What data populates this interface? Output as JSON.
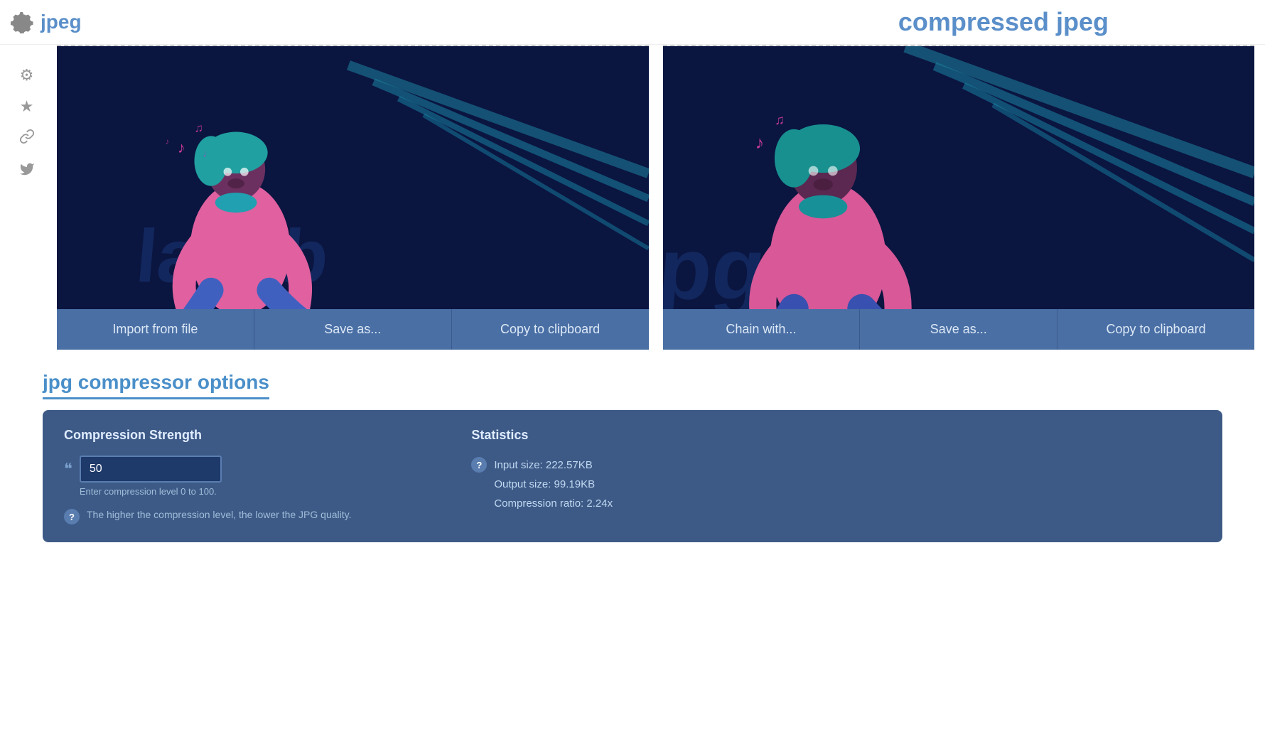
{
  "header": {
    "app_title": "jpeg",
    "compressed_title": "compressed jpeg"
  },
  "sidebar": {
    "icons": [
      {
        "name": "gear-icon",
        "symbol": "⚙"
      },
      {
        "name": "star-icon",
        "symbol": "★"
      },
      {
        "name": "link-icon",
        "symbol": "🔗"
      },
      {
        "name": "twitter-icon",
        "symbol": "🐦"
      }
    ]
  },
  "left_panel": {
    "buttons": [
      {
        "name": "import-from-file-button",
        "label": "Import from file"
      },
      {
        "name": "save-as-left-button",
        "label": "Save as..."
      },
      {
        "name": "copy-to-clipboard-left-button",
        "label": "Copy to clipboard"
      }
    ]
  },
  "right_panel": {
    "buttons": [
      {
        "name": "chain-with-button",
        "label": "Chain with..."
      },
      {
        "name": "save-as-right-button",
        "label": "Save as..."
      },
      {
        "name": "copy-to-clipboard-right-button",
        "label": "Copy to clipboard"
      }
    ]
  },
  "options": {
    "section_title": "jpg compressor options",
    "compression_strength_label": "Compression Strength",
    "compression_value": "50",
    "compression_placeholder": "Enter compression level 0 to 100.",
    "compression_hint": "Enter compression level 0 to 100.",
    "help_text": "The higher the compression level, the lower the JPG quality.",
    "stats_label": "Statistics",
    "input_size": "Input size: 222.57KB",
    "output_size": "Output size: 99.19KB",
    "compression_ratio": "Compression ratio: 2.24x"
  },
  "colors": {
    "accent": "#4a8fc9",
    "panel_bg": "#3d5a87",
    "image_bg": "#0d1a4a",
    "button_bg": "#4a6fa5",
    "title_color": "#5b8fc9"
  }
}
